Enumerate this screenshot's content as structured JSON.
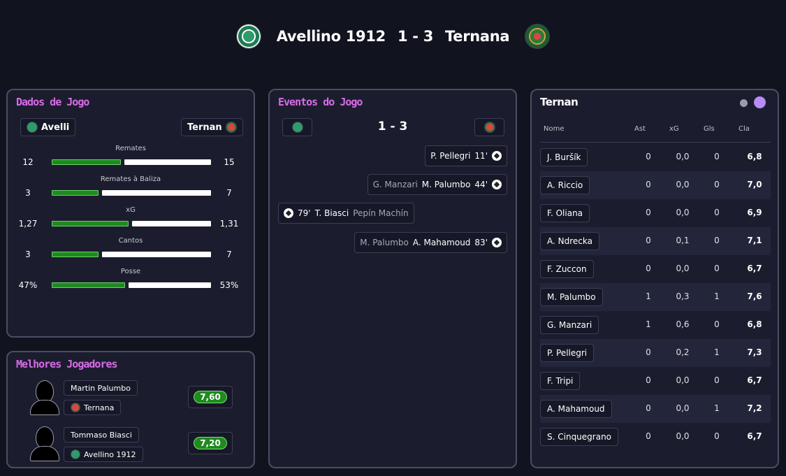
{
  "header": {
    "home_team": "Avellino 1912",
    "score": "1 - 3",
    "away_team": "Ternana"
  },
  "match_stats": {
    "title": "Dados de Jogo",
    "home_chip": "Avelli",
    "away_chip": "Ternan",
    "rows": [
      {
        "label": "Remates",
        "home": "12",
        "away": "15",
        "home_share": 0.444
      },
      {
        "label": "Remates à Baliza",
        "home": "3",
        "away": "7",
        "home_share": 0.3
      },
      {
        "label": "xG",
        "home": "1,27",
        "away": "1,31",
        "home_share": 0.492
      },
      {
        "label": "Cantos",
        "home": "3",
        "away": "7",
        "home_share": 0.3
      },
      {
        "label": "Posse",
        "home": "47%",
        "away": "53%",
        "home_share": 0.47
      }
    ]
  },
  "events": {
    "title": "Eventos do Jogo",
    "score": "1 - 3",
    "items": [
      {
        "side": "away",
        "assist": "",
        "player": "P. Pellegri",
        "minute": "11'"
      },
      {
        "side": "away",
        "assist": "G. Manzari",
        "player": "M. Palumbo",
        "minute": "44'"
      },
      {
        "side": "home",
        "assist": "Pepín Machín",
        "player": "T. Biasci",
        "minute": "79'"
      },
      {
        "side": "away",
        "assist": "M. Palumbo",
        "player": "A. Mahamoud",
        "minute": "83'"
      }
    ]
  },
  "best_players": {
    "title": "Melhores Jogadores",
    "items": [
      {
        "name": "Martin Palumbo",
        "team": "Ternana",
        "rating": "7,60"
      },
      {
        "name": "Tommaso Biasci",
        "team": "Avellino 1912",
        "rating": "7,20"
      }
    ]
  },
  "lineup": {
    "title": "Ternan",
    "columns": [
      "Nome",
      "Ast",
      "xG",
      "Gls",
      "Cla"
    ],
    "players": [
      {
        "name": "J. Buršík",
        "ast": "0",
        "xg": "0,0",
        "gls": "0",
        "cla": "6,8"
      },
      {
        "name": "A. Riccio",
        "ast": "0",
        "xg": "0,0",
        "gls": "0",
        "cla": "7,0"
      },
      {
        "name": "F. Oliana",
        "ast": "0",
        "xg": "0,0",
        "gls": "0",
        "cla": "6,9"
      },
      {
        "name": "A. Ndrecka",
        "ast": "0",
        "xg": "0,1",
        "gls": "0",
        "cla": "7,1"
      },
      {
        "name": "F. Zuccon",
        "ast": "0",
        "xg": "0,0",
        "gls": "0",
        "cla": "6,7"
      },
      {
        "name": "M. Palumbo",
        "ast": "1",
        "xg": "0,3",
        "gls": "1",
        "cla": "7,6"
      },
      {
        "name": "G. Manzari",
        "ast": "1",
        "xg": "0,6",
        "gls": "0",
        "cla": "6,8"
      },
      {
        "name": "P. Pellegri",
        "ast": "0",
        "xg": "0,2",
        "gls": "1",
        "cla": "7,3"
      },
      {
        "name": "F. Tripi",
        "ast": "0",
        "xg": "0,0",
        "gls": "0",
        "cla": "6,7"
      },
      {
        "name": "A. Mahamoud",
        "ast": "0",
        "xg": "0,0",
        "gls": "1",
        "cla": "7,2"
      },
      {
        "name": "S. Cinquegrano",
        "ast": "0",
        "xg": "0,0",
        "gls": "0",
        "cla": "6,7"
      }
    ]
  },
  "colors": {
    "accent_title": "#d96be8",
    "bar_home": "#1f8a1f",
    "bar_away": "#ffffff",
    "toggle_active": "#b98cf5",
    "toggle_inactive": "#9a9cab"
  },
  "icons": {
    "home_logo": "avellino-crest-icon",
    "away_logo": "ternana-crest-icon",
    "goal": "soccer-ball-icon",
    "player": "player-silhouette-icon"
  }
}
